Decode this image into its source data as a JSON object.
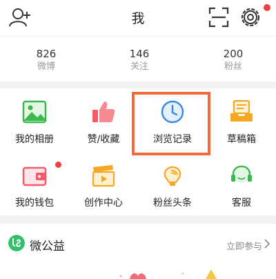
{
  "header": {
    "title": "我",
    "icons": [
      "add-user-icon",
      "scan-icon",
      "gear-icon"
    ],
    "settings_badge_color": "#f03d3d"
  },
  "stats": [
    {
      "value": "826",
      "label": "微博"
    },
    {
      "value": "146",
      "label": "关注"
    },
    {
      "value": "200",
      "label": "粉丝"
    }
  ],
  "grid": {
    "items": [
      {
        "label": "我的相册",
        "icon": "photo-album-icon"
      },
      {
        "label": "赞/收藏",
        "icon": "thumbs-up-icon"
      },
      {
        "label": "浏览记录",
        "icon": "clock-history-icon"
      },
      {
        "label": "草稿箱",
        "icon": "drafts-tray-icon"
      },
      {
        "label": "我的钱包",
        "icon": "wallet-icon",
        "badge": true
      },
      {
        "label": "创作中心",
        "icon": "clapperboard-icon"
      },
      {
        "label": "粉丝头条",
        "icon": "bulb-signal-icon"
      },
      {
        "label": "客服",
        "icon": "headset-icon"
      }
    ],
    "highlight_color": "#f06a3c"
  },
  "welfare": {
    "title": "微公益",
    "action": "立即参与",
    "accent": "#33c06a"
  }
}
